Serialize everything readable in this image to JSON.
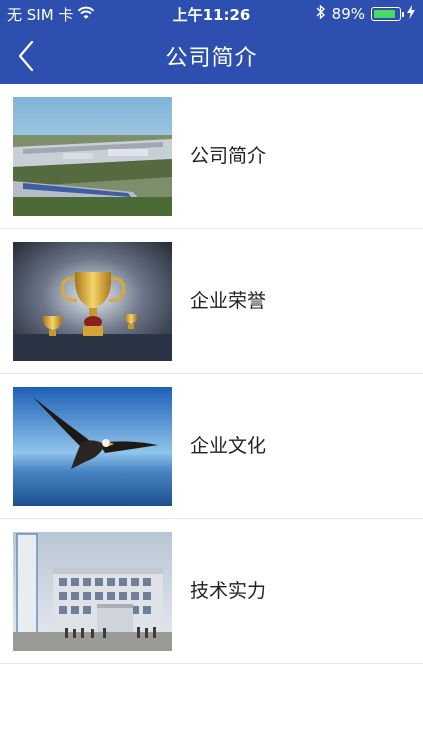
{
  "status_bar": {
    "carrier": "无 SIM 卡",
    "time": "上午11:26",
    "battery_percent": "89%",
    "battery_level": 0.89
  },
  "nav": {
    "title": "公司简介",
    "back_icon": "chevron-left-icon"
  },
  "colors": {
    "navbar_blue": "#2d50b0",
    "battery_green": "#4cd964",
    "divider": "#e6e6e6"
  },
  "list": {
    "items": [
      {
        "label": "公司简介",
        "thumb": "factory-aerial-photo"
      },
      {
        "label": "企业荣誉",
        "thumb": "trophy-photo"
      },
      {
        "label": "企业文化",
        "thumb": "eagle-photo"
      },
      {
        "label": "技术实力",
        "thumb": "research-building-photo"
      }
    ]
  }
}
